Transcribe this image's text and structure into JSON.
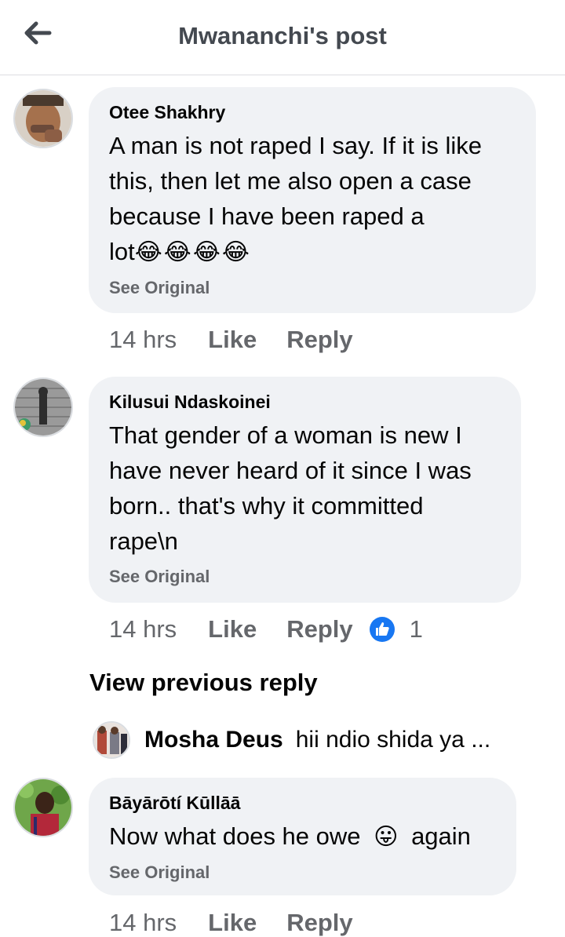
{
  "header": {
    "title": "Mwananchi's post",
    "back_icon": "arrow-left-icon"
  },
  "comments": [
    {
      "author": "Otee Shakhry",
      "text_line1": "A man is not raped I say. If it is like",
      "text_line2": "this, then let me also open a case",
      "text_line3": "because I have been raped a",
      "text_line4": "lot",
      "emoji": "😂😂😂😂",
      "see_original": "See Original",
      "time": "14 hrs",
      "like": "Like",
      "reply": "Reply"
    },
    {
      "author": "Kilusui Ndaskoinei",
      "text_line1": "That gender of a woman is new I",
      "text_line2": "have never heard of it since I was",
      "text_line3": "born.. that's why it committed",
      "text_line4": "rape\\n",
      "see_original": "See Original",
      "time": "14 hrs",
      "like": "Like",
      "reply": "Reply",
      "reaction_count": "1",
      "reaction_icon": "like-reaction-icon"
    },
    {
      "author": "Bāyārōtí Kūllāā",
      "text_before": "Now what does he owe",
      "emoji": "😛",
      "text_after": "again",
      "see_original": "See Original",
      "time": "14 hrs",
      "like": "Like",
      "reply": "Reply"
    }
  ],
  "view_previous": "View previous reply",
  "reply_preview": {
    "author": "Mosha Deus",
    "text": "hii ndio shida ya ..."
  },
  "colors": {
    "bubble": "#f0f2f5",
    "secondary_text": "#65676b",
    "like_blue": "#1877f2"
  }
}
